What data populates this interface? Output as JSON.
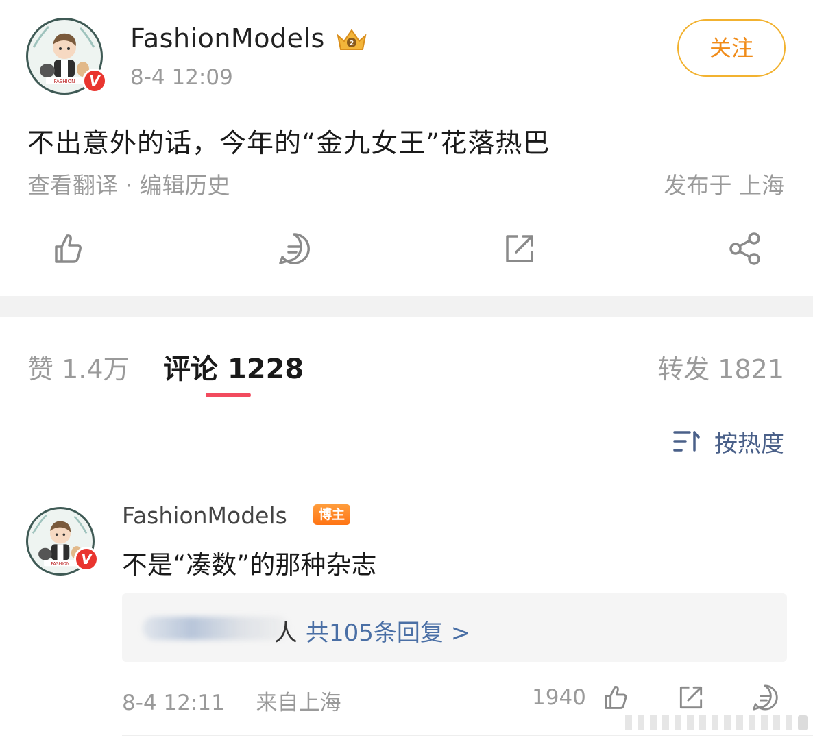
{
  "post": {
    "author": "FashionModels",
    "time": "8-4 12:09",
    "follow_label": "关注",
    "text": "不出意外的话，今年的“金九女王”花落热巴",
    "translate_label": "查看翻译",
    "meta_separator": " · ",
    "edit_history_label": "编辑历史",
    "location": "发布于 上海",
    "verified_mark": "V",
    "actions": [
      "like-icon",
      "comment-icon",
      "repost-icon",
      "share-icon"
    ]
  },
  "tabs": {
    "like": "赞 1.4万",
    "comment": "评论 1228",
    "repost": "转发 1821"
  },
  "sort": {
    "label": "按热度",
    "icon": "sort-icon"
  },
  "comment": {
    "author": "FashionModels",
    "badge": "博主",
    "text": "不是“凑数”的那种杂志",
    "reply_people": "人",
    "reply_count": "共105条回复 >",
    "time": "8-4 12:11",
    "location": "来自上海",
    "likes": "1940",
    "verified_mark": "V"
  },
  "colors": {
    "accent_follow": "#f08c1a",
    "tab_underline": "#f24b5e",
    "link_blue": "#4a6fa5",
    "badge_orange": "#ff7414"
  }
}
